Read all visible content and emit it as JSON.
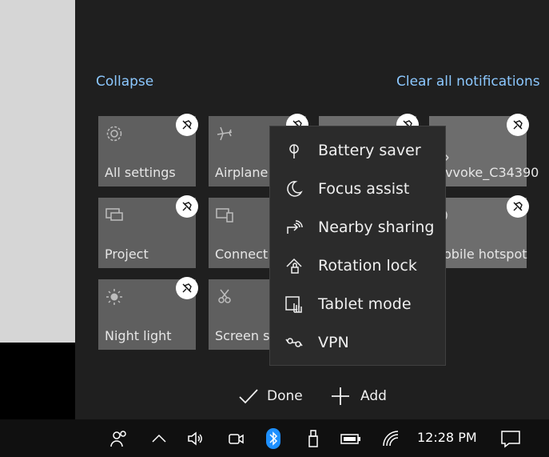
{
  "action_center": {
    "collapse_label": "Collapse",
    "clear_label": "Clear all notifications",
    "tiles": [
      {
        "label": "All settings",
        "icon": "gear-icon"
      },
      {
        "label": "Airplane m",
        "icon": "airplane-icon"
      },
      {
        "label": "",
        "icon": ""
      },
      {
        "label": "vvoke_C34390",
        "icon": "network-icon"
      },
      {
        "label": "Project",
        "icon": "project-icon"
      },
      {
        "label": "Connect",
        "icon": "connect-icon"
      },
      {
        "label": "obile hotspot",
        "icon": "hotspot-icon"
      },
      {
        "label": "Night light",
        "icon": "night-light-icon"
      },
      {
        "label": "Screen sn",
        "icon": "screen-snip-icon"
      }
    ],
    "done_label": "Done",
    "add_label": "Add"
  },
  "add_menu": {
    "items": [
      {
        "label": "Battery saver",
        "icon": "battery-saver-icon"
      },
      {
        "label": "Focus assist",
        "icon": "moon-icon"
      },
      {
        "label": "Nearby sharing",
        "icon": "nearby-sharing-icon"
      },
      {
        "label": "Rotation lock",
        "icon": "rotation-lock-icon"
      },
      {
        "label": "Tablet mode",
        "icon": "tablet-mode-icon"
      },
      {
        "label": "VPN",
        "icon": "vpn-icon"
      }
    ]
  },
  "taskbar": {
    "time": "12:28 PM",
    "icons": [
      "people-icon",
      "chevron-up-icon",
      "volume-icon",
      "meet-now-icon",
      "bluetooth-icon",
      "usb-icon",
      "battery-icon",
      "wifi-icon",
      "notifications-icon"
    ]
  },
  "colors": {
    "accent_link": "#8cc8ff",
    "tile_bg": "#5f5f5f",
    "bluetooth": "#1e90ff"
  }
}
